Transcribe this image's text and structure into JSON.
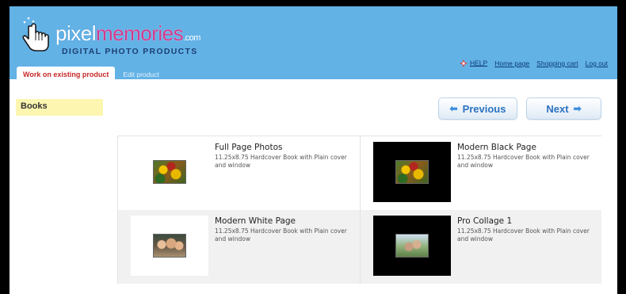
{
  "brand": {
    "name_part1": "pixel",
    "name_part2": "memories",
    "name_suffix": ".com",
    "tagline": "DIGITAL PHOTO PRODUCTS",
    "colors": {
      "header": "#62b2e6",
      "accent": "#d23a8c"
    }
  },
  "header_links": {
    "help": "HELP",
    "home": "Home page",
    "cart": "Shopping cart",
    "logout": "Log out",
    "help_icon": "puzzle-help-icon"
  },
  "tabs": {
    "active": "Work on existing product",
    "inactive": "Edit product"
  },
  "category": "Books",
  "nav_buttons": {
    "previous": "Previous",
    "next": "Next"
  },
  "products": [
    {
      "title": "Full Page Photos",
      "desc": "11.25x8.75 Hardcover Book with Plain cover and window",
      "thumb_bg": "white",
      "photo": "flowers"
    },
    {
      "title": "Modern Black Page",
      "desc": "11.25x8.75 Hardcover Book with Plain cover and window",
      "thumb_bg": "black",
      "photo": "flowers"
    },
    {
      "title": "Modern White Page",
      "desc": "11.25x8.75 Hardcover Book with Plain cover and window",
      "thumb_bg": "white",
      "photo": "people"
    },
    {
      "title": "Pro Collage 1",
      "desc": "11.25x8.75 Hardcover Book with Plain cover and window",
      "thumb_bg": "black",
      "photo": "outdoor"
    }
  ]
}
